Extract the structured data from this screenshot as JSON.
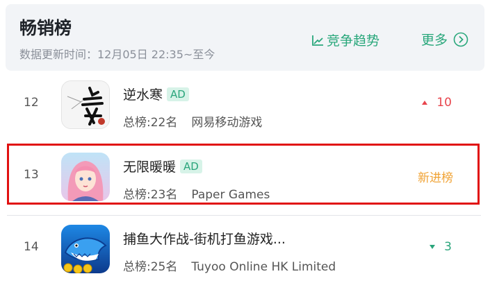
{
  "header": {
    "title": "畅销榜",
    "subtitle": "数据更新时间：12月05日 22:35~至今",
    "trend_label": "竞争趋势",
    "more_label": "更多"
  },
  "ad_label": "AD",
  "colors": {
    "accent": "#29a77b",
    "up": "#e8454d",
    "new": "#f0a233",
    "highlight": "#e11010"
  },
  "rows": [
    {
      "rank": "12",
      "name": "逆水寒",
      "ad": true,
      "overall": "总榜:22名",
      "developer": "网易移动游戏",
      "change": "10",
      "change_type": "up",
      "icon": "nishuihan-app-icon"
    },
    {
      "rank": "13",
      "name": "无限暖暖",
      "ad": true,
      "overall": "总榜:23名",
      "developer": "Paper Games",
      "change": "新进榜",
      "change_type": "new",
      "icon": "infinity-nikki-app-icon"
    },
    {
      "rank": "14",
      "name": "捕鱼大作战-街机打鱼游戏...",
      "ad": false,
      "overall": "总榜:25名",
      "developer": "Tuyoo Online HK Limited",
      "change": "3",
      "change_type": "down",
      "icon": "fishing-game-app-icon"
    }
  ]
}
